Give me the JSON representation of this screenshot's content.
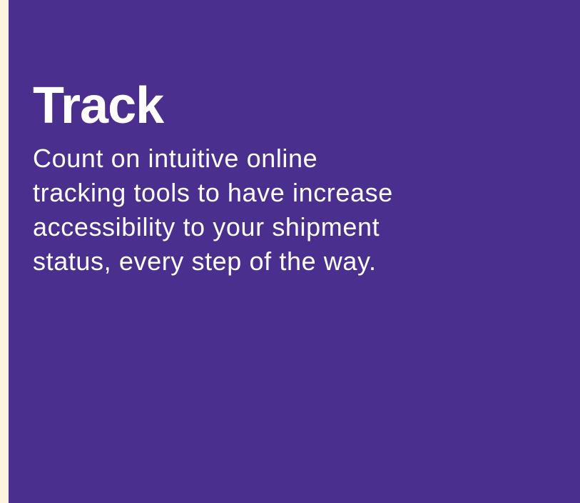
{
  "colors": {
    "panel_background": "#4a2f8f",
    "page_background": "#fdf3df",
    "text": "#ffffff"
  },
  "card": {
    "title": "Track",
    "body_lines": [
      "Count on intuitive online",
      "tracking tools to have increase",
      "accessibility to your shipment",
      "status, every step of the way."
    ]
  }
}
